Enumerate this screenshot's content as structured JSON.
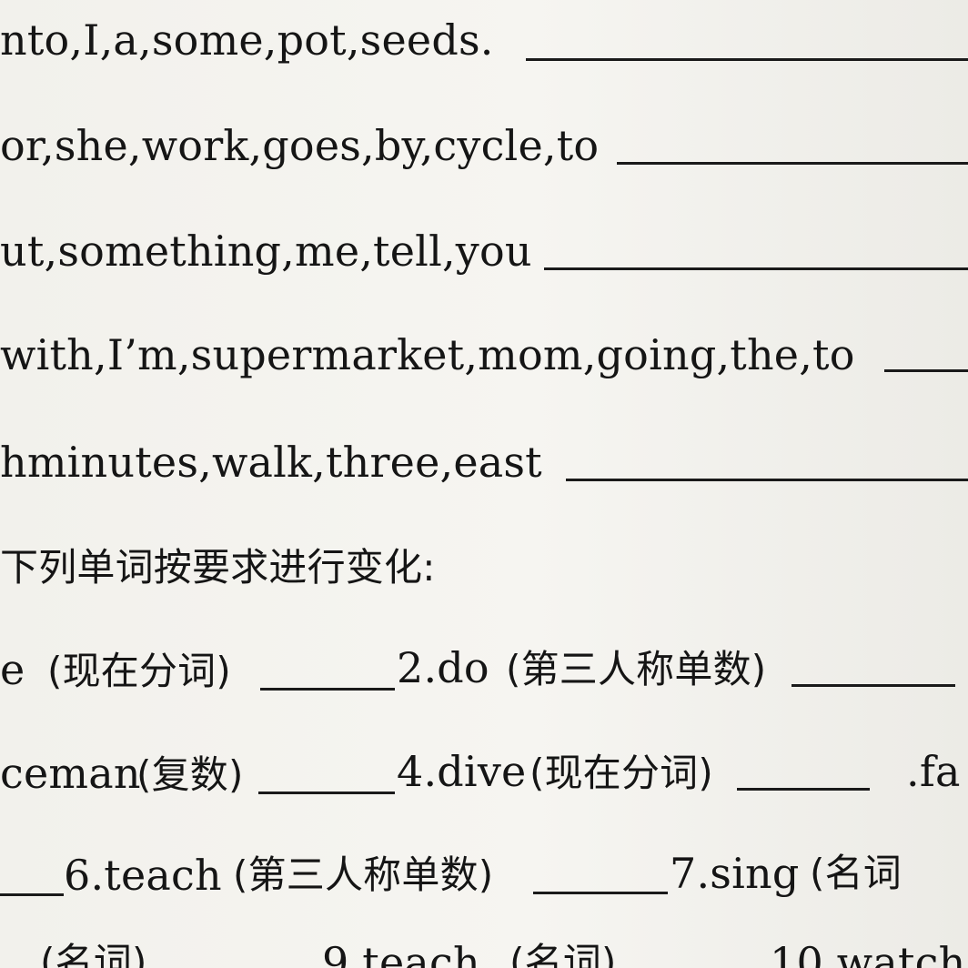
{
  "section1": {
    "items": [
      {
        "text": "nto,I,a,some,pot,seeds."
      },
      {
        "text": "or,she,work,goes,by,cycle,to"
      },
      {
        "text": "ut,something,me,tell,you"
      },
      {
        "text": "with,I’m,supermarket,mom,going,the,to"
      },
      {
        "text": "hminutes,walk,three,east"
      }
    ]
  },
  "section2": {
    "heading": "下列单词按要求进行变化:",
    "row1": {
      "a_word": "e",
      "a_hint": "(现在分词)",
      "b_word": "2.do",
      "b_hint": "(第三人称单数)"
    },
    "row2": {
      "a_word": "ceman",
      "a_hint": "(复数)",
      "b_word": "4.dive",
      "b_hint": "(现在分词)",
      "c_word": ".fa"
    },
    "row3": {
      "b_word": "6.teach",
      "b_hint": "(第三人称单数)",
      "c_word": "7.sing",
      "c_hint": "(名词"
    },
    "row4": {
      "a_hint": "(名词)",
      "b_word": "9.teach",
      "b_hint": "(名词)",
      "c_word": "10.watch"
    }
  }
}
